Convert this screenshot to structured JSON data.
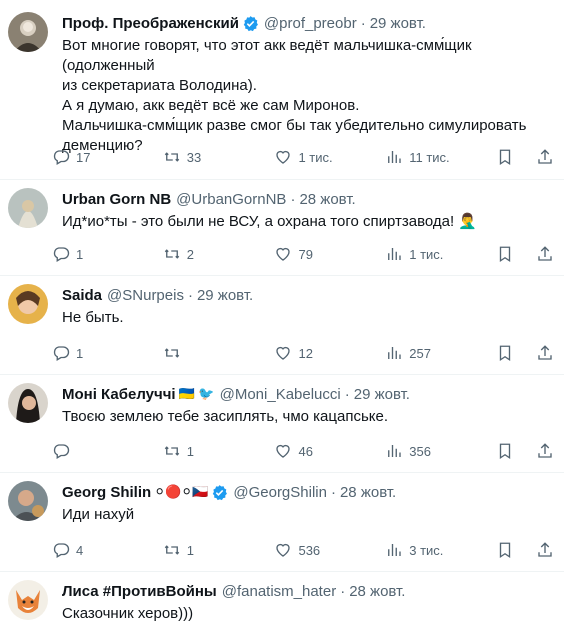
{
  "tweets": [
    {
      "name": "Проф. Преображенский",
      "handle": "@prof_preobr",
      "date": "29 жовт.",
      "verified": true,
      "text": "Вот многие говорят, что этот акк ведёт мальчишка-смм́щик (одолженный\nиз секретариата Володина).\nА я думаю, акк ведёт всё же сам Миронов.\nМальчишка-смм́щик разве смог бы так убедительно симулировать\nдеменцию?",
      "replies": "17",
      "retweets": "33",
      "likes": "1 тис.",
      "views": "11 тис."
    },
    {
      "name": "Urban Gorn NB",
      "handle": "@UrbanGornNB",
      "date": "28 жовт.",
      "text": "Ид*ио*ты - это были не ВСУ, а охрана того спиртзавода! 🤦‍♂️",
      "replies": "1",
      "retweets": "2",
      "likes": "79",
      "views": "1 тис."
    },
    {
      "name": "Saida",
      "handle": "@SNurpeis",
      "date": "29 жовт.",
      "text": "Не быть.",
      "replies": "1",
      "retweets": "",
      "likes": "12",
      "views": "257"
    },
    {
      "name": "Моні Кабелуччі",
      "name_emoji": "🇺🇦 🐦",
      "handle": "@Moni_Kabelucci",
      "date": "29 жовт.",
      "text": "Твоєю землею тебе засиплять, чмо кацапське.",
      "replies": "",
      "retweets": "1",
      "likes": "46",
      "views": "356"
    },
    {
      "name": "Georg Shilin",
      "name_emoji": "⚪🔴⚪🇨🇿",
      "handle": "@GeorgShilin",
      "date": "28 жовт.",
      "verified": true,
      "text": "Иди нахуй",
      "replies": "4",
      "retweets": "1",
      "likes": "536",
      "views": "3 тис."
    },
    {
      "name": "Лиса #ПротивВойны",
      "handle": "@fanatism_hater",
      "date": "28 жовт.",
      "text": "Сказочник херов)))"
    }
  ],
  "colors": {
    "verified": "#1d9bf0",
    "secondary": "#536471",
    "text": "#0f1419"
  },
  "icons": [
    "reply-icon",
    "retweet-icon",
    "like-icon",
    "views-icon",
    "bookmark-icon",
    "share-icon",
    "verified-badge-icon"
  ]
}
